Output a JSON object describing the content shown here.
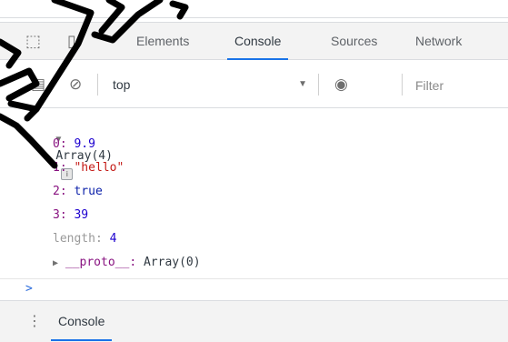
{
  "devtools": {
    "tabs": [
      {
        "label": "Elements",
        "active": false
      },
      {
        "label": "Console",
        "active": true
      },
      {
        "label": "Sources",
        "active": false
      },
      {
        "label": "Network",
        "active": false
      }
    ],
    "icons": {
      "inspect": "cursor-select-icon",
      "device": "device-toolbar-icon",
      "sidebar": "console-sidebar-icon",
      "clear": "clear-console-icon",
      "eye": "live-expression-icon",
      "caret": "dropdown-caret-icon",
      "menu": "kebab-menu-icon"
    }
  },
  "toolbar": {
    "context": "top",
    "filter_placeholder": "Filter"
  },
  "console": {
    "entry_header": "Array(4)",
    "items": [
      {
        "key": "0",
        "value": "9.9",
        "type": "number"
      },
      {
        "key": "1",
        "value": "\"hello\"",
        "type": "string"
      },
      {
        "key": "2",
        "value": "true",
        "type": "boolean"
      },
      {
        "key": "3",
        "value": "39",
        "type": "number"
      }
    ],
    "length_label": "length",
    "length_value": "4",
    "proto_label": "__proto__",
    "proto_value": "Array(0)",
    "prompt": ">"
  },
  "drawer": {
    "tab_label": "Console"
  },
  "colors": {
    "accent": "#1a73e8",
    "string": "#c41a16",
    "number": "#1c00cf",
    "key": "#881280",
    "overlay_ink": "#000000"
  }
}
